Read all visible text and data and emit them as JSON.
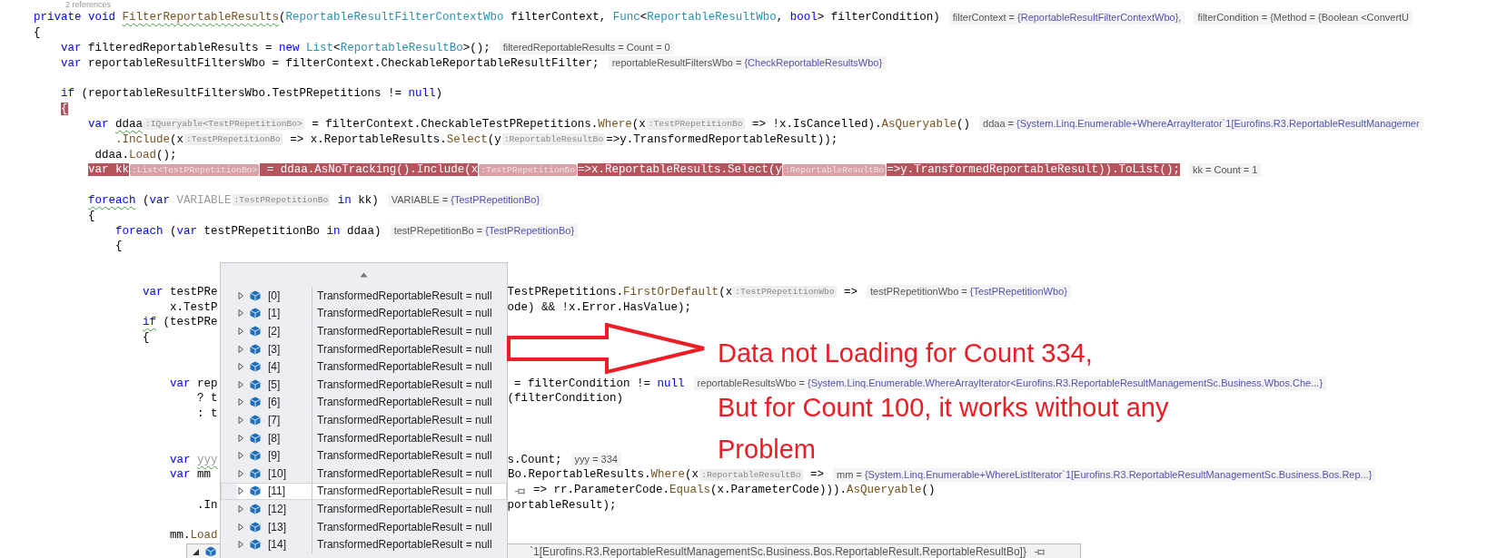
{
  "editor": {
    "codelens": "2 references",
    "lines": [
      {
        "kind": "code",
        "tokens": [
          {
            "kind": "kw",
            "text": "private void "
          },
          {
            "kind": "fnw",
            "text": "FilterReportableResults"
          },
          {
            "kind": "txt",
            "text": "("
          },
          {
            "kind": "type",
            "text": "ReportableResultFilterContextWbo"
          },
          {
            "kind": "txt",
            "text": " filterContext, "
          },
          {
            "kind": "type",
            "text": "Func"
          },
          {
            "kind": "txt",
            "text": "<"
          },
          {
            "kind": "type",
            "text": "ReportableResultWbo"
          },
          {
            "kind": "txt",
            "text": ", "
          },
          {
            "kind": "kw",
            "text": "bool"
          },
          {
            "kind": "txt",
            "text": "> filterCondition)"
          }
        ],
        "tips": [
          {
            "label": "filterContext = ",
            "value": "{ReportableResultFilterContextWbo},"
          },
          {
            "label": "filterCondition = {Method = {Boolean <ConvertU"
          }
        ]
      },
      {
        "kind": "code",
        "tokens": [
          {
            "kind": "txt",
            "text": "{"
          }
        ]
      },
      {
        "kind": "code",
        "tokens": [
          {
            "kind": "kw",
            "text": "    var"
          },
          {
            "kind": "txt",
            "text": " filteredReportableResults = "
          },
          {
            "kind": "kw",
            "text": "new "
          },
          {
            "kind": "type",
            "text": "List"
          },
          {
            "kind": "txt",
            "text": "<"
          },
          {
            "kind": "type",
            "text": "ReportableResultBo"
          },
          {
            "kind": "txt",
            "text": ">();"
          }
        ],
        "tips": [
          {
            "label": "filteredReportableResults = Count = 0"
          }
        ]
      },
      {
        "kind": "code",
        "tokens": [
          {
            "kind": "kw",
            "text": "    var"
          },
          {
            "kind": "txt",
            "text": " reportableResultFiltersWbo = filterContext.CheckableReportableResultFilter;"
          }
        ],
        "tips": [
          {
            "label": "reportableResultFiltersWbo = ",
            "value": "{CheckReportableResultsWbo}"
          }
        ]
      },
      {
        "kind": "blank"
      },
      {
        "kind": "code",
        "tokens": [
          {
            "kind": "kw",
            "text": "    if"
          },
          {
            "kind": "txt",
            "text": " (reportableResultFiltersWbo.TestPRepetitions != "
          },
          {
            "kind": "kw",
            "text": "null"
          },
          {
            "kind": "txt",
            "text": ")"
          }
        ]
      },
      {
        "kind": "code",
        "tokens": [
          {
            "kind": "match",
            "text": "    {"
          }
        ]
      },
      {
        "kind": "code",
        "tokens": [
          {
            "kind": "kw",
            "text": "        var "
          },
          {
            "kind": "txtw",
            "text": "ddaa"
          },
          {
            "kind": "hint",
            "text": ":IQueryable<TestPRepetitionBo>"
          },
          {
            "kind": "txt",
            "text": " = filterContext.CheckableTestPRepetitions."
          },
          {
            "kind": "fn",
            "text": "Where"
          },
          {
            "kind": "txt",
            "text": "(x"
          },
          {
            "kind": "hint",
            "text": ":TestPRepetitionBo"
          },
          {
            "kind": "txt",
            "text": " => !x.IsCancelled)."
          },
          {
            "kind": "fn",
            "text": "AsQueryable"
          },
          {
            "kind": "txt",
            "text": "()"
          }
        ],
        "tips": [
          {
            "label": "ddaa = ",
            "value": "{System.Linq.Enumerable+WhereArrayIterator`1[Eurofins.R3.ReportableResultManagemer"
          }
        ]
      },
      {
        "kind": "code",
        "tokens": [
          {
            "kind": "fn",
            "text": "            .Include"
          },
          {
            "kind": "txt",
            "text": "(x"
          },
          {
            "kind": "hint",
            "text": ":TestPRepetitionBo"
          },
          {
            "kind": "txt",
            "text": " => x.ReportableResults."
          },
          {
            "kind": "fn",
            "text": "Select"
          },
          {
            "kind": "txt",
            "text": "(y"
          },
          {
            "kind": "hint",
            "text": ":ReportableResultBo"
          },
          {
            "kind": "txt",
            "text": "=>y.TransformedReportableResult));"
          }
        ]
      },
      {
        "kind": "code",
        "tokens": [
          {
            "kind": "txt",
            "text": "         ddaa."
          },
          {
            "kind": "fn",
            "text": "Load"
          },
          {
            "kind": "txt",
            "text": "();"
          }
        ]
      },
      {
        "kind": "code",
        "highlight": true,
        "tokens": [
          {
            "kind": "kw",
            "text": "        var"
          },
          {
            "kind": "txt",
            "text": " kk"
          },
          {
            "kind": "hint",
            "text": ":List<TestPRepetitionBo>"
          },
          {
            "kind": "txt",
            "text": " = ddaa.AsNoTracking().Include(x"
          },
          {
            "kind": "hint",
            "text": ":TestPRepetitionBo"
          },
          {
            "kind": "txt",
            "text": "=>x.ReportableResults.Select(y"
          },
          {
            "kind": "hint",
            "text": ":ReportableResultBo"
          },
          {
            "kind": "txt",
            "text": "=>y.TransformedReportableResult)).ToList();"
          }
        ],
        "tips": [
          {
            "label": "kk = Count = 1"
          }
        ]
      },
      {
        "kind": "blank"
      },
      {
        "kind": "code",
        "tokens": [
          {
            "kind": "kww",
            "text": "        foreach"
          },
          {
            "kind": "txt",
            "text": " ("
          },
          {
            "kind": "kw",
            "text": "var "
          },
          {
            "kind": "dim",
            "text": "VARIABLE"
          },
          {
            "kind": "hint",
            "text": ":TestPRepetitionBo"
          },
          {
            "kind": "kw",
            "text": " in"
          },
          {
            "kind": "txt",
            "text": " kk)"
          }
        ],
        "tips": [
          {
            "label": "VARIABLE = ",
            "value": "{TestPRepetitionBo}"
          }
        ]
      },
      {
        "kind": "code",
        "tokens": [
          {
            "kind": "txt",
            "text": "        {"
          }
        ]
      },
      {
        "kind": "code",
        "tokens": [
          {
            "kind": "kw",
            "text": "            foreach"
          },
          {
            "kind": "txt",
            "text": " ("
          },
          {
            "kind": "kw",
            "text": "var"
          },
          {
            "kind": "txt",
            "text": " testPRepetitionBo "
          },
          {
            "kind": "kw",
            "text": "in"
          },
          {
            "kind": "txt",
            "text": " ddaa)"
          }
        ],
        "tips": [
          {
            "label": "testPRepetitionBo = ",
            "value": "{TestPRepetitionBo}"
          }
        ]
      },
      {
        "kind": "code",
        "tokens": [
          {
            "kind": "txt",
            "text": "            {"
          }
        ]
      },
      {
        "kind": "blank"
      },
      {
        "kind": "blank"
      },
      {
        "kind": "code",
        "tokens": [
          {
            "kind": "kw",
            "text": "                var"
          },
          {
            "kind": "txt",
            "text": " testPRe"
          },
          {
            "kind": "gap"
          },
          {
            "kind": "txt",
            "text": "TestPRepetitions."
          },
          {
            "kind": "fn",
            "text": "FirstOrDefault"
          },
          {
            "kind": "txt",
            "text": "(x"
          },
          {
            "kind": "hint",
            "text": ":TestPRepetitionWbo"
          },
          {
            "kind": "txt",
            "text": " =>"
          }
        ],
        "tips": [
          {
            "label": "testPRepetitionWbo = ",
            "value": "{TestPRepetitionWbo}"
          }
        ]
      },
      {
        "kind": "code",
        "tokens": [
          {
            "kind": "txt",
            "text": "                    x.TestP"
          },
          {
            "kind": "gap"
          },
          {
            "kind": "txt",
            "text": "ode) && !x.Error.HasValue);"
          }
        ]
      },
      {
        "kind": "code",
        "tokens": [
          {
            "kind": "kww",
            "text": "                if"
          },
          {
            "kind": "txt",
            "text": " (testPRe"
          }
        ]
      },
      {
        "kind": "code",
        "tokens": [
          {
            "kind": "txt",
            "text": "                {"
          }
        ]
      },
      {
        "kind": "blank"
      },
      {
        "kind": "blank"
      },
      {
        "kind": "code",
        "tokens": [
          {
            "kind": "kw",
            "text": "                    var"
          },
          {
            "kind": "txt",
            "text": " rep"
          },
          {
            "kind": "gap"
          },
          {
            "kind": "txt",
            "text": " = filterCondition != "
          },
          {
            "kind": "kw",
            "text": "null"
          }
        ],
        "tips": [
          {
            "label": "reportableResultsWbo = ",
            "value": "{System.Linq.Enumerable.WhereArrayIterator<Eurofins.R3.ReportableResultManagementSc.Business.Wbos.Che...}"
          }
        ]
      },
      {
        "kind": "code",
        "tokens": [
          {
            "kind": "txt",
            "text": "                        ? t"
          },
          {
            "kind": "gap"
          },
          {
            "kind": "txt",
            "text": "(filterCondition)"
          }
        ]
      },
      {
        "kind": "code",
        "tokens": [
          {
            "kind": "txt",
            "text": "                        : t"
          }
        ]
      },
      {
        "kind": "blank"
      },
      {
        "kind": "blank"
      },
      {
        "kind": "code",
        "tokens": [
          {
            "kind": "kw",
            "text": "                    var "
          },
          {
            "kind": "dimw",
            "text": "yyy"
          },
          {
            "kind": "gap"
          },
          {
            "kind": "txt",
            "text": "s.Count;"
          }
        ],
        "tips": [
          {
            "label": "yyy = 334"
          }
        ]
      },
      {
        "kind": "code",
        "tokens": [
          {
            "kind": "kw",
            "text": "                    var"
          },
          {
            "kind": "txt",
            "text": " mm"
          },
          {
            "kind": "gap"
          },
          {
            "kind": "txt",
            "text": "Bo.ReportableResults."
          },
          {
            "kind": "fn",
            "text": "Where"
          },
          {
            "kind": "txt",
            "text": "(x"
          },
          {
            "kind": "hint",
            "text": ":ReportableResultBo"
          },
          {
            "kind": "txt",
            "text": " =>"
          }
        ],
        "tips": [
          {
            "label": "mm = ",
            "value": "{System.Linq.Enumerable+WhereListIterator`1[Eurofins.R3.ReportableResultManagementSc.Business.Bos.Rep...}"
          }
        ]
      },
      {
        "kind": "code",
        "tokens": [
          {
            "kind": "gapwide"
          },
          {
            "kind": "txt",
            "text": "=> rr.ParameterCode."
          },
          {
            "kind": "fn",
            "text": "Equals"
          },
          {
            "kind": "txt",
            "text": "(x.ParameterCode)))."
          },
          {
            "kind": "fn",
            "text": "AsQueryable"
          },
          {
            "kind": "txt",
            "text": "()"
          }
        ]
      },
      {
        "kind": "code",
        "tokens": [
          {
            "kind": "txt",
            "text": "                        .In"
          },
          {
            "kind": "gap"
          },
          {
            "kind": "txt",
            "text": "portableResult);"
          }
        ]
      },
      {
        "kind": "blank"
      },
      {
        "kind": "code",
        "tokens": [
          {
            "kind": "txt",
            "text": "                    mm."
          },
          {
            "kind": "fn",
            "text": "Load"
          }
        ]
      }
    ]
  },
  "datatip_popup": {
    "rows": [
      {
        "name": "[0]",
        "value": "TransformedReportableResult = null",
        "selected": false
      },
      {
        "name": "[1]",
        "value": "TransformedReportableResult = null",
        "selected": false
      },
      {
        "name": "[2]",
        "value": "TransformedReportableResult = null",
        "selected": false
      },
      {
        "name": "[3]",
        "value": "TransformedReportableResult = null",
        "selected": false
      },
      {
        "name": "[4]",
        "value": "TransformedReportableResult = null",
        "selected": false
      },
      {
        "name": "[5]",
        "value": "TransformedReportableResult = null",
        "selected": false
      },
      {
        "name": "[6]",
        "value": "TransformedReportableResult = null",
        "selected": false
      },
      {
        "name": "[7]",
        "value": "TransformedReportableResult = null",
        "selected": false
      },
      {
        "name": "[8]",
        "value": "TransformedReportableResult = null",
        "selected": false
      },
      {
        "name": "[9]",
        "value": "TransformedReportableResult = null",
        "selected": false
      },
      {
        "name": "[10]",
        "value": "TransformedReportableResult = null",
        "selected": false
      },
      {
        "name": "[11]",
        "value": "TransformedReportableResult = null",
        "selected": true
      },
      {
        "name": "[12]",
        "value": "TransformedReportableResult = null",
        "selected": false
      },
      {
        "name": "[13]",
        "value": "TransformedReportableResult = null",
        "selected": false
      },
      {
        "name": "[14]",
        "value": "TransformedReportableResult = null",
        "selected": false
      }
    ]
  },
  "parent_datatip": {
    "expanded": true,
    "text": "`1[Eurofins.R3.ReportableResultManagementSc.Business.Bos.ReportableResult.ReportableResultBo]}"
  },
  "annotation": {
    "lines": [
      "Data not Loading for Count 334,",
      "But for Count 100, it works without any",
      "Problem"
    ]
  }
}
